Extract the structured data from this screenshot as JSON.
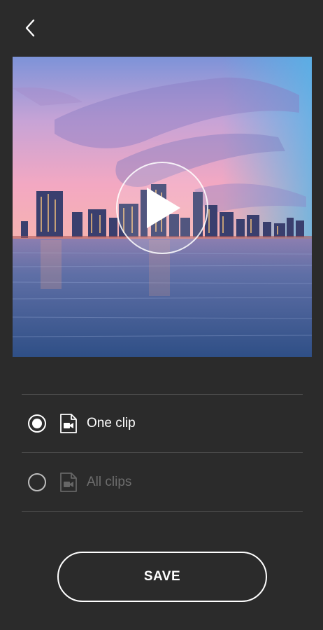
{
  "header": {
    "back_icon": "chevron-left-icon"
  },
  "preview": {
    "play_icon": "play-icon",
    "colors": {
      "sky_top": "#6a8fd6",
      "sky_pink": "#f2a9c4",
      "water": "#3b5c92"
    }
  },
  "options": [
    {
      "label": "One clip",
      "selected": true,
      "enabled": true,
      "icon": "video-file-icon"
    },
    {
      "label": "All clips",
      "selected": false,
      "enabled": false,
      "icon": "video-file-icon"
    }
  ],
  "save": {
    "label": "SAVE"
  }
}
